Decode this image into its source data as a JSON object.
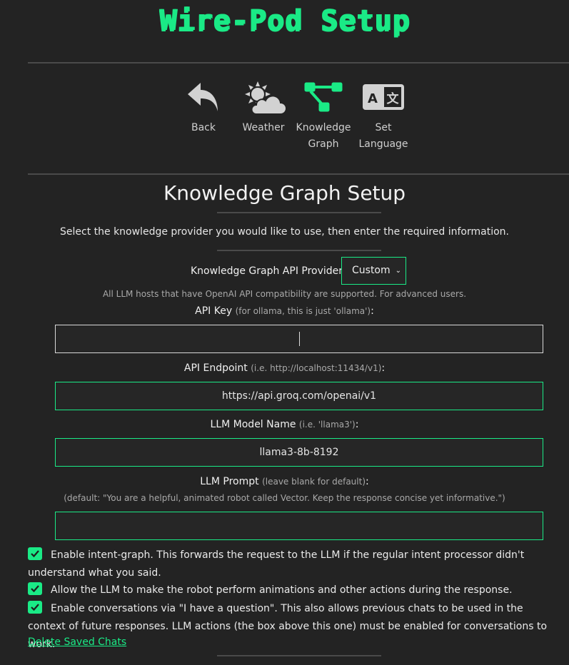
{
  "page": {
    "title": "Wire-Pod Setup"
  },
  "nav": [
    {
      "label": "Back",
      "icon": "back-arrow-icon"
    },
    {
      "label": "Weather",
      "icon": "weather-icon"
    },
    {
      "label": "Knowledge Graph",
      "icon": "knowledge-graph-icon"
    },
    {
      "label": "Set Language",
      "icon": "language-icon"
    }
  ],
  "section": {
    "heading": "Knowledge Graph Setup",
    "intro": "Select the knowledge provider you would like to use, then enter the required information."
  },
  "provider": {
    "label": "Knowledge Graph API Provider:",
    "selected": "Custom",
    "note": "All LLM hosts that have OpenAI API compatibility are supported. For advanced users."
  },
  "api_key": {
    "label": "API Key",
    "hint": "(for ollama, this is just 'ollama')",
    "value": ""
  },
  "endpoint": {
    "label": "API Endpoint",
    "hint": "(i.e. http://localhost:11434/v1)",
    "value": "https://api.groq.com/openai/v1"
  },
  "model": {
    "label": "LLM Model Name",
    "hint": "(i.e. 'llama3')",
    "value": "llama3-8b-8192"
  },
  "prompt": {
    "label": "LLM Prompt",
    "hint": "(leave blank for default)",
    "default_note": "(default: \"You are a helpful, animated robot called Vector. Keep the response concise yet informative.\")",
    "value": ""
  },
  "checks": [
    {
      "checked": true,
      "text": "Enable intent-graph. This forwards the request to the LLM if the regular intent processor didn't understand what you said."
    },
    {
      "checked": true,
      "text": "Allow the LLM to make the robot perform animations and other actions during the response."
    },
    {
      "checked": true,
      "text": "Enable conversations via \"I have a question\". This also allows previous chats to be used in the context of future responses. LLM actions (the box above this one) must be enabled for conversations to work."
    }
  ],
  "delete_link": "Delete Saved Chats",
  "colors": {
    "accent": "#1aea86",
    "background": "#232323"
  }
}
